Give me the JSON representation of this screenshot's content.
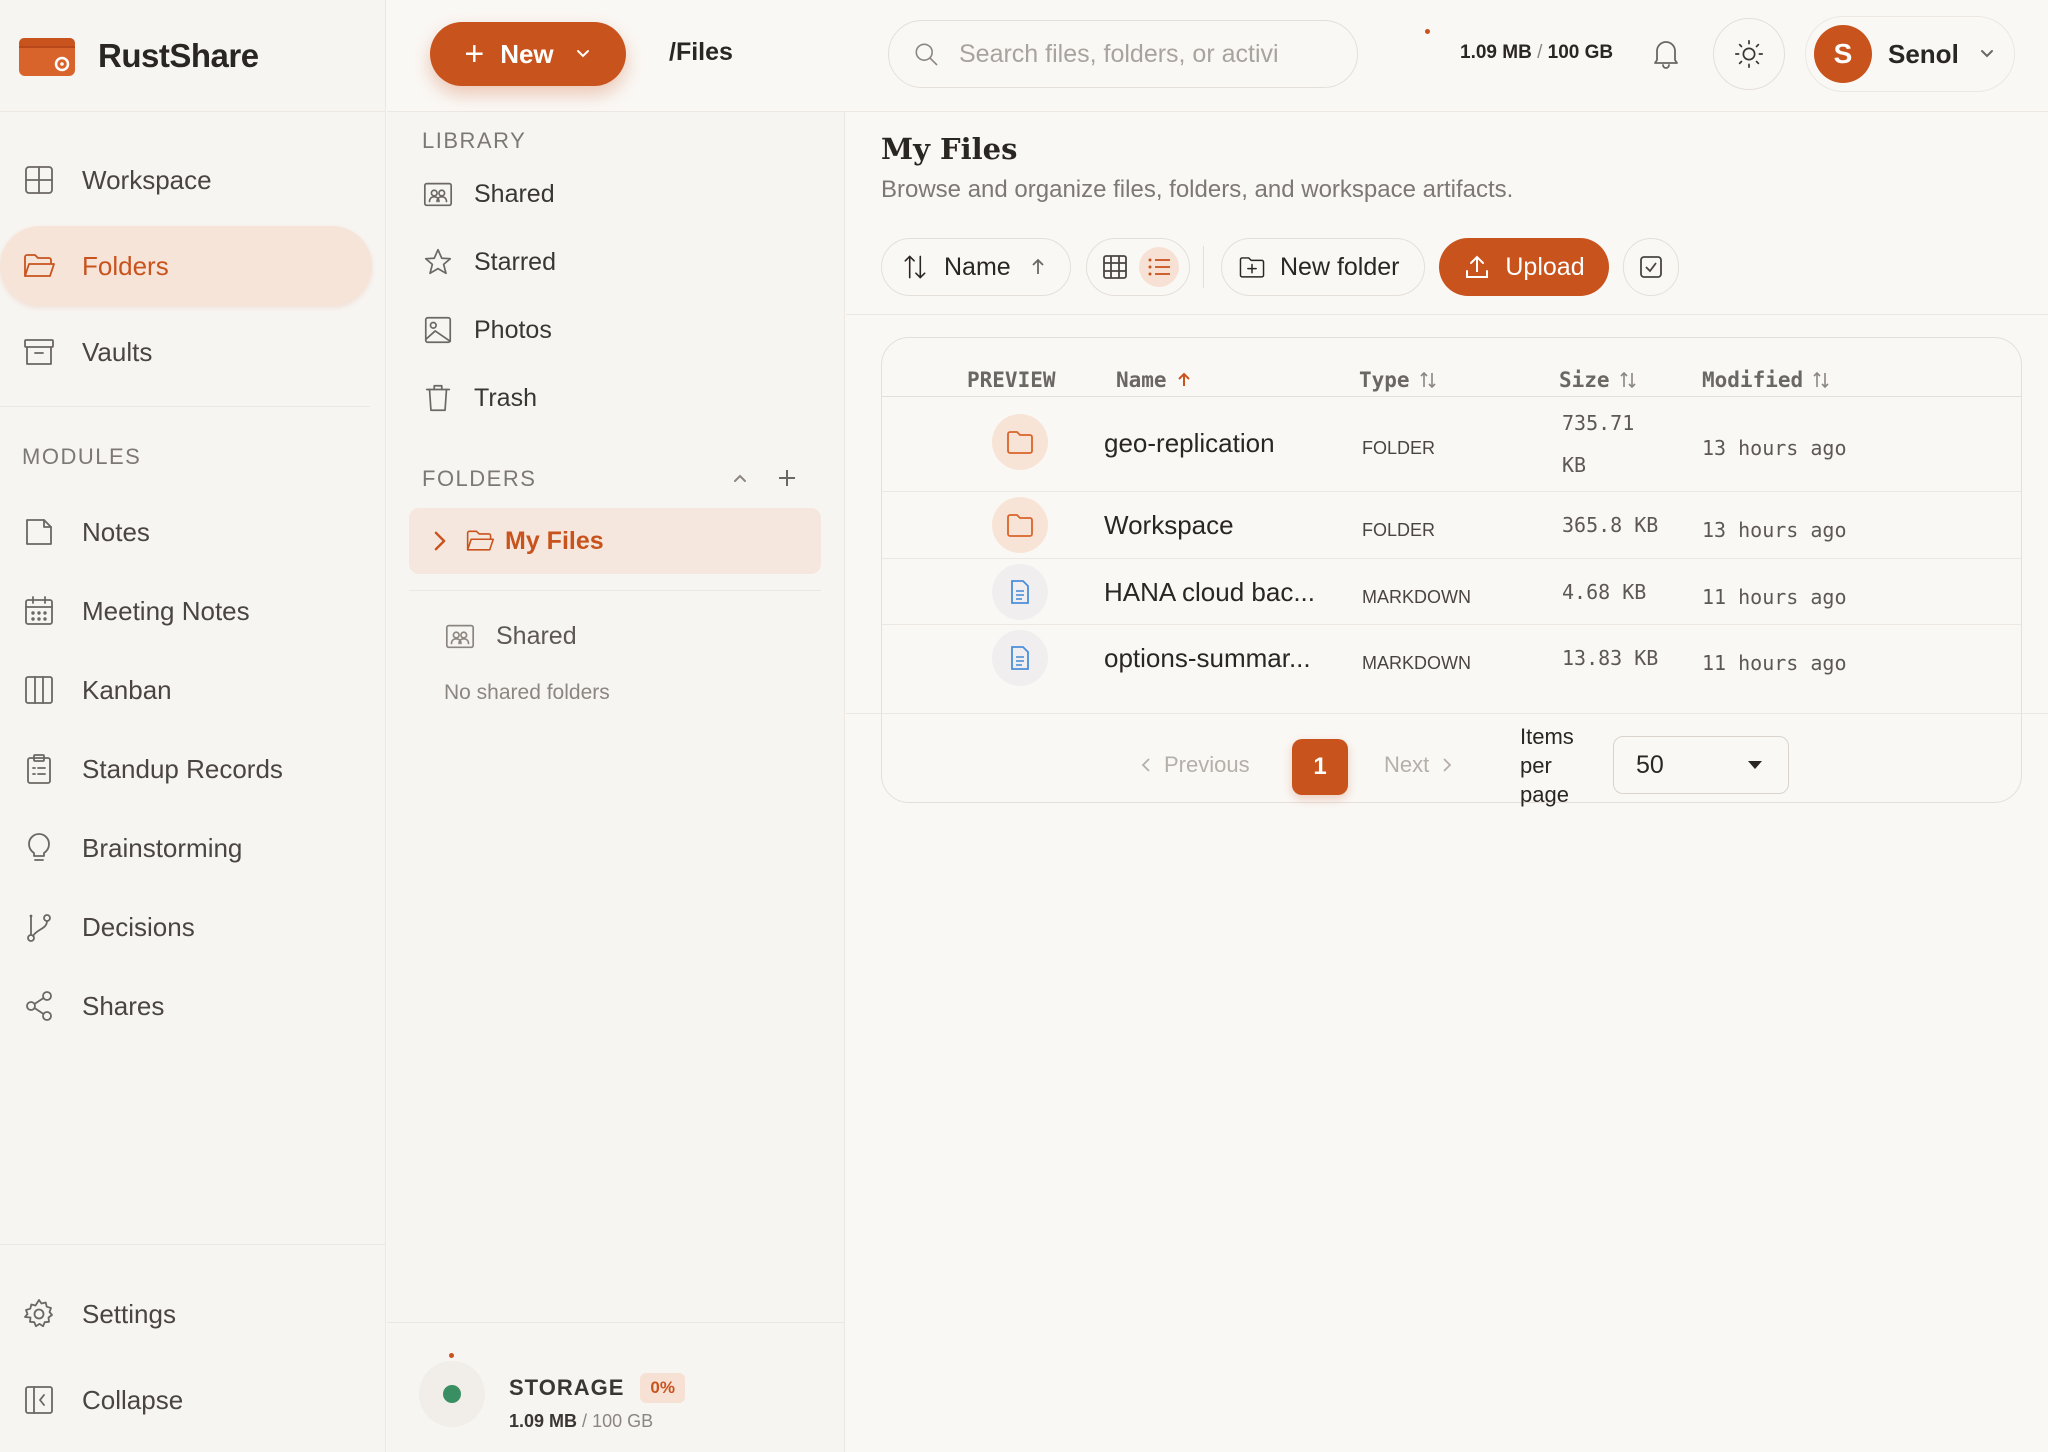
{
  "app": {
    "name": "RustShare"
  },
  "header": {
    "new_label": "New",
    "path": "/Files",
    "search_placeholder": "Search files, folders, or activi",
    "usage_used": "1.09 MB",
    "usage_sep": "/",
    "usage_total": "100 GB",
    "user_initial": "S",
    "user_name": "Senol"
  },
  "sidebar": {
    "main_items": [
      {
        "label": "Workspace",
        "icon": "grid-icon"
      },
      {
        "label": "Folders",
        "icon": "folder-open-icon",
        "active": true
      },
      {
        "label": "Vaults",
        "icon": "archive-icon"
      }
    ],
    "modules_label": "MODULES",
    "modules": [
      {
        "label": "Notes",
        "icon": "note-icon"
      },
      {
        "label": "Meeting Notes",
        "icon": "calendar-icon"
      },
      {
        "label": "Kanban",
        "icon": "columns-icon"
      },
      {
        "label": "Standup Records",
        "icon": "clipboard-icon"
      },
      {
        "label": "Brainstorming",
        "icon": "lightbulb-icon"
      },
      {
        "label": "Decisions",
        "icon": "branch-icon"
      },
      {
        "label": "Shares",
        "icon": "share-icon"
      }
    ],
    "settings_label": "Settings",
    "collapse_label": "Collapse"
  },
  "library": {
    "label": "LIBRARY",
    "items": [
      {
        "label": "Shared",
        "icon": "shared-folder-icon"
      },
      {
        "label": "Starred",
        "icon": "star-icon"
      },
      {
        "label": "Photos",
        "icon": "image-icon"
      },
      {
        "label": "Trash",
        "icon": "trash-icon"
      }
    ],
    "folders_label": "FOLDERS",
    "active_folder": "My Files",
    "shared_label": "Shared",
    "no_shared": "No shared folders",
    "storage_title": "STORAGE",
    "storage_pct": "0%",
    "storage_pct_value": 0,
    "storage_used": "1.09 MB",
    "storage_sep": "/",
    "storage_total": "100 GB"
  },
  "main": {
    "title": "My Files",
    "subtitle": "Browse and organize files, folders, and workspace artifacts.",
    "sort_label": "Name",
    "new_folder_label": "New folder",
    "upload_label": "Upload",
    "columns": {
      "preview": "PREVIEW",
      "name": "Name",
      "type": "Type",
      "size": "Size",
      "modified": "Modified"
    },
    "rows": [
      {
        "kind": "folder",
        "name": "geo-replication",
        "type": "FOLDER",
        "size": "735.71 KB",
        "modified": "13 hours ago"
      },
      {
        "kind": "folder",
        "name": "Workspace",
        "type": "FOLDER",
        "size": "365.8 KB",
        "modified": "13 hours ago"
      },
      {
        "kind": "doc",
        "name": "HANA cloud bac...",
        "type": "MARKDOWN",
        "size": "4.68 KB",
        "modified": "11 hours ago"
      },
      {
        "kind": "doc",
        "name": "options-summar...",
        "type": "MARKDOWN",
        "size": "13.83 KB",
        "modified": "11 hours ago"
      }
    ],
    "pagination": {
      "previous": "Previous",
      "page": "1",
      "next": "Next",
      "items_per_page_label": "Items per page",
      "items_per_page": "50"
    }
  },
  "colors": {
    "accent": "#c9531d",
    "accent_soft": "#f6e4d9",
    "storage_dot": "#3a8f62"
  }
}
